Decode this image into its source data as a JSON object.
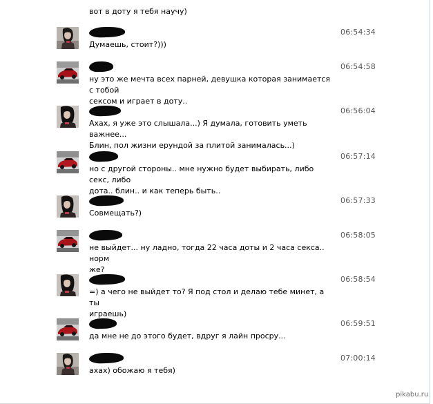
{
  "top_text": "вот в доту я тебя научу)",
  "messages": [
    {
      "time": "06:54:34",
      "text": "Думаешь, стоит?)))",
      "avatar": "girl-avatar-icon"
    },
    {
      "time": "06:54:58",
      "text": "ну это же мечта всех парней, девушка которая занимается с тобой\nсексом и играет в доту..",
      "avatar": "car-avatar-icon"
    },
    {
      "time": "06:56:04",
      "text": "Ахах, я уже это слышала...) Я думала, готовить уметь важнее...\nБлин, пол жизни ерундой за плитой занималась...)",
      "avatar": "girl-avatar-icon"
    },
    {
      "time": "06:57:14",
      "text": "но с другой стороны.. мне нужно будет выбирать, либо секс, либо\nдота.. блин.. и как теперь быть..",
      "avatar": "car-avatar-icon"
    },
    {
      "time": "06:57:33",
      "text": "Совмещать?)",
      "avatar": "girl-avatar-icon"
    },
    {
      "time": "06:58:05",
      "text": "не выйдет... ну ладно, тогда 22 часа доты и 2 часа секса.. норм\nже?",
      "avatar": "car-avatar-icon"
    },
    {
      "time": "06:58:54",
      "text": "=) а чего не выйдет то? Я под стол и делаю тебе минет, а ты\nиграешь)",
      "avatar": "girl-avatar-icon"
    },
    {
      "time": "06:59:51",
      "text": "да мне не до этого будет, вдруг я лайн просру...",
      "avatar": "car-avatar-icon"
    },
    {
      "time": "07:00:14",
      "text": "ахах) обожаю я тебя)",
      "avatar": "girl-avatar-icon"
    }
  ],
  "watermark": "pikabu.ru"
}
